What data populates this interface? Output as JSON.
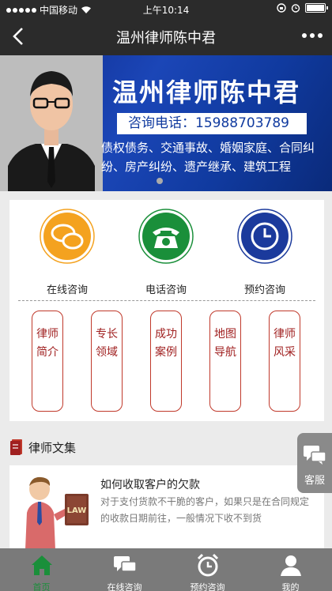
{
  "status_bar": {
    "carrier": "中国移动",
    "time": "上午10:14"
  },
  "nav": {
    "title": "温州律师陈中君"
  },
  "banner": {
    "name": "温州律师陈中君",
    "phone": "咨询电话：15988703789",
    "areas": "债权债务、交通事故、婚姻家庭、合同纠纷、房产纠纷、遗产继承、建筑工程"
  },
  "quick_actions": [
    {
      "label": "在线咨询",
      "icon": "chat-bubbles-icon",
      "color": "#f4a21f"
    },
    {
      "label": "电话咨询",
      "icon": "telephone-icon",
      "color": "#1a8f3a"
    },
    {
      "label": "预约咨询",
      "icon": "clock-icon",
      "color": "#1b3a9c"
    }
  ],
  "nav_pills": [
    {
      "label": "律师简介"
    },
    {
      "label": "专长领域"
    },
    {
      "label": "成功案例"
    },
    {
      "label": "地图导航"
    },
    {
      "label": "律师风采"
    }
  ],
  "section": {
    "title": "律师文集"
  },
  "article": {
    "title": "如何收取客户的欠款",
    "desc": "对于支付货款不干脆的客户，如果只是在合同规定的收款日期前往，一般情况下收不到货",
    "book_label": "LAW"
  },
  "float_service": {
    "label": "客服"
  },
  "tabbar": [
    {
      "label": "首页",
      "icon": "home-icon",
      "active": true
    },
    {
      "label": "在线咨询",
      "icon": "chat-icon"
    },
    {
      "label": "预约咨询",
      "icon": "alarm-clock-icon"
    },
    {
      "label": "我的",
      "icon": "user-icon"
    }
  ],
  "colors": {
    "accent_green": "#1a8f3a",
    "pill_red": "#c0392b",
    "banner_blue": "#1b46b7"
  }
}
